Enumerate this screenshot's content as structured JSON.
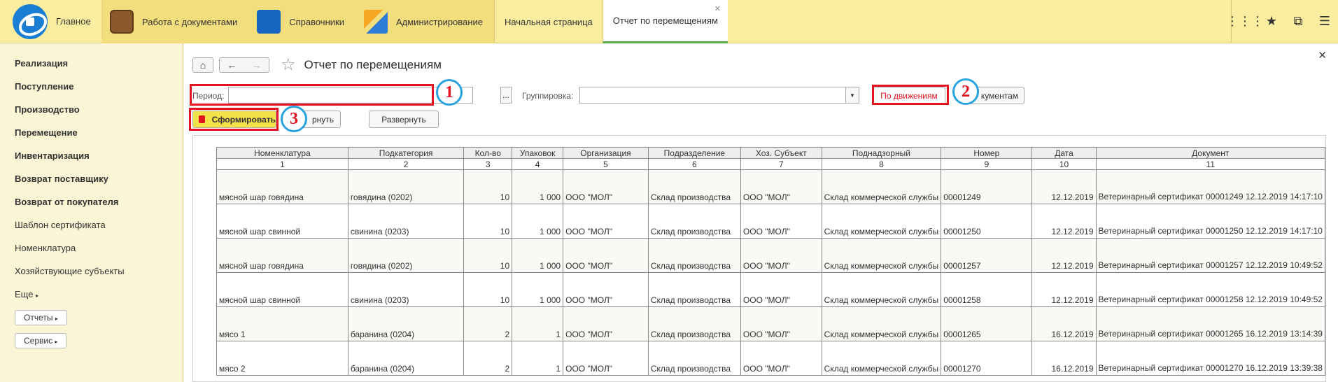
{
  "top": {
    "home_label": "Главное",
    "sections": [
      "Работа с документами",
      "Справочники",
      "Администрирование"
    ],
    "tabs": [
      "Начальная страница",
      "Отчет по перемещениям"
    ],
    "icons": [
      "apps-grid-icon",
      "star-icon",
      "history-icon",
      "menu-icon"
    ]
  },
  "sidebar": {
    "items": [
      "Реализация",
      "Поступление",
      "Производство",
      "Перемещение",
      "Инвентаризация",
      "Возврат поставщику",
      "Возврат от покупателя",
      "Шаблон сертификата",
      "Номенклатура",
      "Хозяйствующие субъекты",
      "Еще"
    ],
    "buttons": [
      "Отчеты",
      "Сервис"
    ]
  },
  "page": {
    "title": "Отчет по перемещениям",
    "period_label": "Период:",
    "period_value": "",
    "ellipsis": "...",
    "grouping_label": "Группировка:",
    "grouping_value": "",
    "btn_by_movements": "По движениям",
    "btn_by_documents": "кументам",
    "btn_generate": "Сформировать",
    "btn_collapse": "рнуть",
    "btn_expand": "Развернуть",
    "markers": [
      "1",
      "2",
      "3"
    ]
  },
  "table": {
    "headers": [
      "Номенклатура",
      "Подкатегория",
      "Кол-во",
      "Упаковок",
      "Организация",
      "Подразделение",
      "Хоз. Субъект",
      "Поднадзорный",
      "Номер",
      "Дата",
      "Документ"
    ],
    "numbers": [
      "1",
      "2",
      "3",
      "4",
      "5",
      "6",
      "7",
      "8",
      "9",
      "10",
      "11"
    ],
    "rows": [
      [
        "мясной шар говядина",
        "говядина (0202)",
        "10",
        "1 000",
        "ООО \"МОЛ\"",
        "Склад производства",
        "ООО \"МОЛ\"",
        "Склад коммерческой службы",
        "00001249",
        "12.12.2019",
        "Ветеринарный сертификат 00001249 12.12.2019 14:17:10"
      ],
      [
        "мясной шар свинной",
        "свинина (0203)",
        "10",
        "1 000",
        "ООО \"МОЛ\"",
        "Склад производства",
        "ООО \"МОЛ\"",
        "Склад коммерческой службы",
        "00001250",
        "12.12.2019",
        "Ветеринарный сертификат 00001250 12.12.2019 14:17:10"
      ],
      [
        "мясной шар говядина",
        "говядина (0202)",
        "10",
        "1 000",
        "ООО \"МОЛ\"",
        "Склад производства",
        "ООО \"МОЛ\"",
        "Склад коммерческой службы",
        "00001257",
        "12.12.2019",
        "Ветеринарный сертификат 00001257 12.12.2019 10:49:52"
      ],
      [
        "мясной шар свинной",
        "свинина (0203)",
        "10",
        "1 000",
        "ООО \"МОЛ\"",
        "Склад производства",
        "ООО \"МОЛ\"",
        "Склад коммерческой службы",
        "00001258",
        "12.12.2019",
        "Ветеринарный сертификат 00001258 12.12.2019 10:49:52"
      ],
      [
        "мясо 1",
        "баранина (0204)",
        "2",
        "1",
        "ООО \"МОЛ\"",
        "Склад производства",
        "ООО \"МОЛ\"",
        "Склад коммерческой службы",
        "00001265",
        "16.12.2019",
        "Ветеринарный сертификат 00001265 16.12.2019 13:14:39"
      ],
      [
        "мясо 2",
        "баранина (0204)",
        "2",
        "1",
        "ООО \"МОЛ\"",
        "Склад производства",
        "ООО \"МОЛ\"",
        "Склад коммерческой службы",
        "00001270",
        "16.12.2019",
        "Ветеринарный сертификат 00001270 16.12.2019 13:39:38"
      ]
    ]
  }
}
